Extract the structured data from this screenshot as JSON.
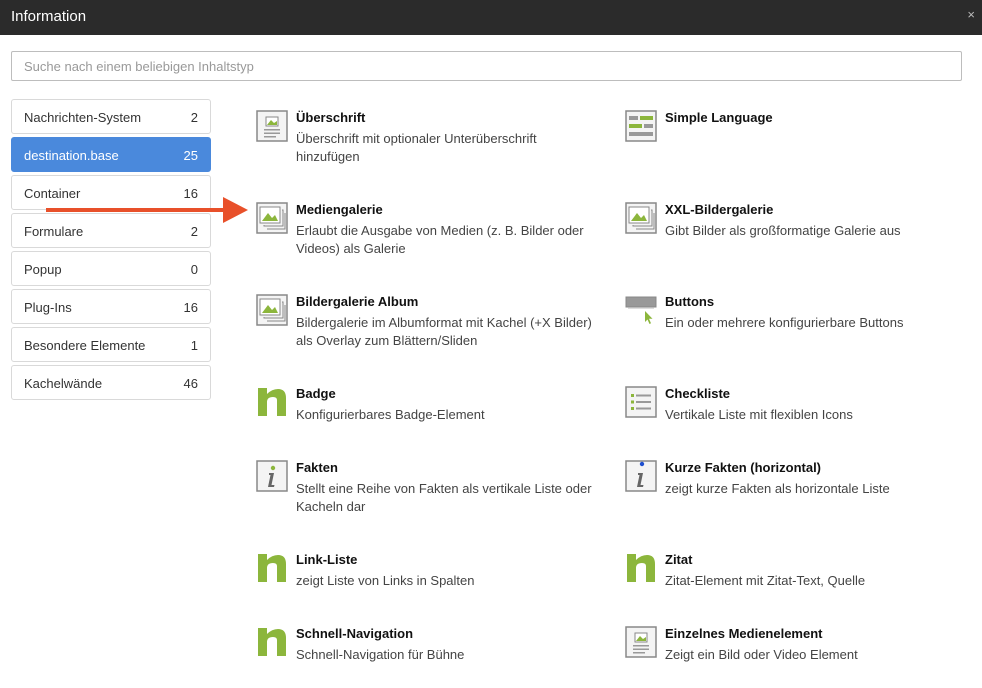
{
  "window": {
    "title": "Information",
    "close_symbol": "×"
  },
  "search": {
    "placeholder": "Suche nach einem beliebigen Inhaltstyp",
    "value": ""
  },
  "categories": [
    {
      "label": "Nachrichten-System",
      "count": "2"
    },
    {
      "label": "destination.base",
      "count": "25",
      "active": true
    },
    {
      "label": "Container",
      "count": "16"
    },
    {
      "label": "Formulare",
      "count": "2"
    },
    {
      "label": "Popup",
      "count": "0"
    },
    {
      "label": "Plug-Ins",
      "count": "16"
    },
    {
      "label": "Besondere Elemente",
      "count": "1"
    },
    {
      "label": "Kachelwände",
      "count": "46"
    }
  ],
  "items": [
    {
      "name": "Überschrift",
      "desc": "Überschrift mit optionaler Unterüberschrift hinzufügen",
      "icon": "heading-image-icon"
    },
    {
      "name": "Simple Language",
      "desc": "",
      "icon": "simple-language-icon"
    },
    {
      "name": "Mediengalerie",
      "desc": "Erlaubt die Ausgabe von Medien (z. B. Bilder oder Videos) als Galerie",
      "icon": "gallery-icon"
    },
    {
      "name": "XXL-Bildergalerie",
      "desc": "Gibt Bilder als großformatige Galerie aus",
      "icon": "gallery-icon"
    },
    {
      "name": "Bildergalerie Album",
      "desc": "Bildergalerie im Albumformat mit Kachel (+X Bilder) als Overlay zum Blättern/Sliden",
      "icon": "gallery-icon"
    },
    {
      "name": "Buttons",
      "desc": "Ein oder mehrere konfigurierbare Buttons",
      "icon": "button-icon"
    },
    {
      "name": "Badge",
      "desc": "Konfigurierbares Badge-Element",
      "icon": "n-logo-icon"
    },
    {
      "name": "Checkliste",
      "desc": "Vertikale Liste mit flexiblen Icons",
      "icon": "checklist-icon"
    },
    {
      "name": "Fakten",
      "desc": "Stellt eine Reihe von Fakten als vertikale Liste oder Kacheln dar",
      "icon": "info-icon"
    },
    {
      "name": "Kurze Fakten (horizontal)",
      "desc": "zeigt kurze Fakten als horizontale Liste",
      "icon": "info-icon"
    },
    {
      "name": "Link-Liste",
      "desc": "zeigt Liste von Links in Spalten",
      "icon": "n-logo-icon"
    },
    {
      "name": "Zitat",
      "desc": "Zitat-Element mit Zitat-Text, Quelle",
      "icon": "n-logo-icon"
    },
    {
      "name": "Schnell-Navigation",
      "desc": "Schnell-Navigation für Bühne",
      "icon": "n-logo-icon"
    },
    {
      "name": "Einzelnes Medienelement",
      "desc": "Zeigt ein Bild oder Video Element",
      "icon": "heading-image-icon"
    }
  ],
  "colors": {
    "titlebar": "#2b2b2b",
    "active_category": "#4a89dc",
    "brand_green": "#8cb63c",
    "arrow": "#e8502a"
  }
}
